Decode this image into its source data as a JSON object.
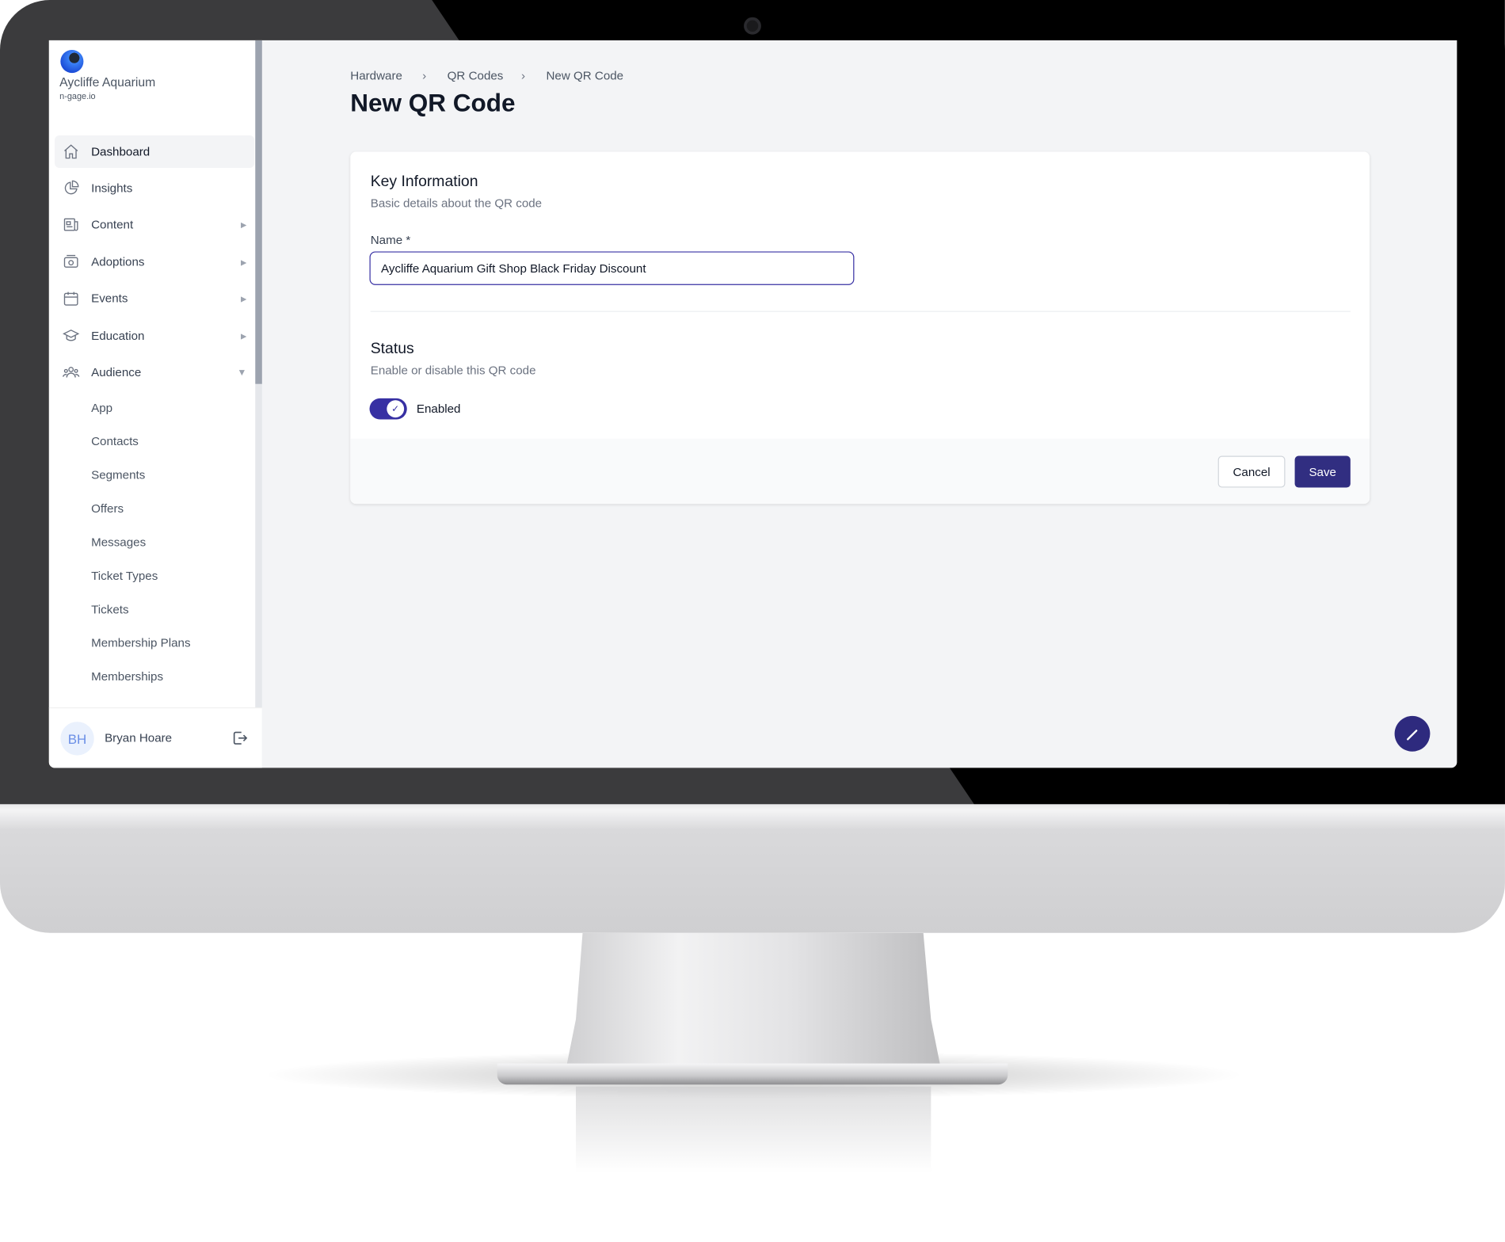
{
  "org": {
    "name": "Aycliffe Aquarium",
    "domain": "n-gage.io"
  },
  "sidebar": {
    "items": [
      {
        "label": "Dashboard",
        "icon": "home-icon",
        "active": true
      },
      {
        "label": "Insights",
        "icon": "pie-chart-icon",
        "expandable": true
      },
      {
        "label": "Content",
        "icon": "newspaper-icon",
        "expandable": true
      },
      {
        "label": "Adoptions",
        "icon": "camera-icon",
        "expandable": true
      },
      {
        "label": "Events",
        "icon": "calendar-icon",
        "expandable": true
      },
      {
        "label": "Education",
        "icon": "graduation-cap-icon",
        "expandable": true
      },
      {
        "label": "Audience",
        "icon": "users-icon",
        "expanded": true
      }
    ],
    "audience_sub": [
      "App",
      "Contacts",
      "Segments",
      "Offers",
      "Messages",
      "Ticket Types",
      "Tickets",
      "Membership Plans",
      "Memberships"
    ]
  },
  "user": {
    "initials": "BH",
    "name": "Bryan Hoare"
  },
  "breadcrumb": [
    "Hardware",
    "QR Codes",
    "New QR Code"
  ],
  "page_title": "New QR Code",
  "form": {
    "key_info": {
      "title": "Key Information",
      "subtitle": "Basic details about the QR code",
      "name_label": "Name *",
      "name_value": "Aycliffe Aquarium Gift Shop Black Friday Discount"
    },
    "status": {
      "title": "Status",
      "subtitle": "Enable or disable this QR code",
      "toggle_label": "Enabled",
      "enabled": true
    },
    "cancel_label": "Cancel",
    "save_label": "Save"
  },
  "colors": {
    "accent": "#312e81",
    "background": "#f3f4f6"
  }
}
